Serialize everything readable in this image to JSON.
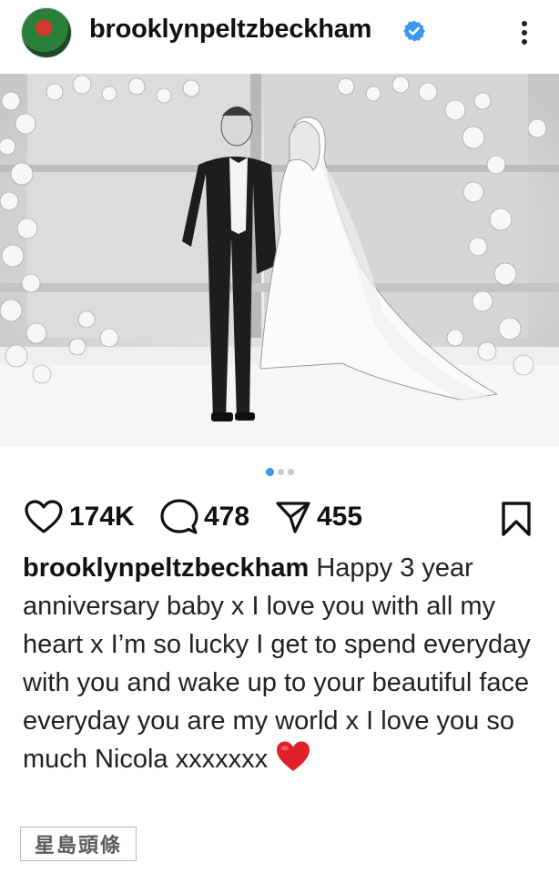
{
  "header": {
    "username": "brooklynpeltzbeckham",
    "verified_color": "#3897f0",
    "more_icon": "more-vertical-icon"
  },
  "post": {
    "image_description_icon": "wedding-photo",
    "carousel": {
      "total": 3,
      "active": 1,
      "active_color": "#3897f0"
    }
  },
  "actions": {
    "likes": "174K",
    "comments": "478",
    "shares": "455"
  },
  "caption": {
    "username": "brooklynpeltzbeckham",
    "text": "Happy 3 year anniversary baby x I love you with all my heart x I’m so lucky I get to spend everyday with you and wake up to your beautiful face everyday you are my world x I love you so much Nicola xxxxxxx",
    "emoji": "red-heart"
  },
  "watermark": {
    "text": "星島頭條"
  }
}
